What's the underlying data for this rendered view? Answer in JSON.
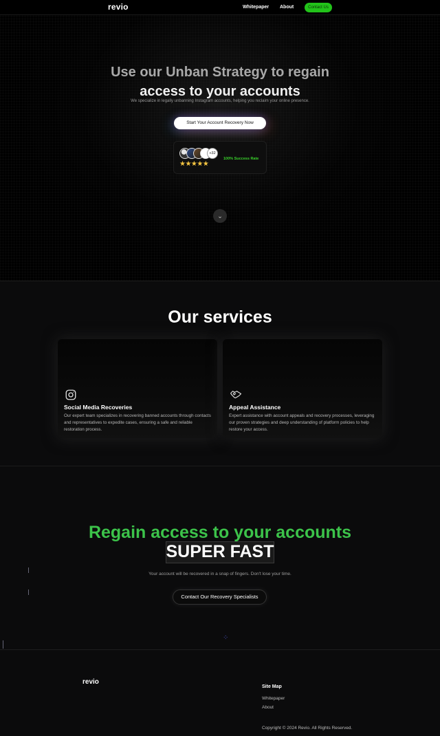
{
  "nav": {
    "logo": "revio",
    "links": [
      "Whitepaper",
      "About"
    ],
    "cta": "Contact Us"
  },
  "hero": {
    "title_line1": "Use our Unban Strategy to regain",
    "title_line2": "access to your accounts",
    "subtitle": "We specialize in legally unbanning Instagram accounts, helping you reclaim your online presence.",
    "button": "Start Your Account Recovery Now",
    "avatar_more": "+32",
    "stars": "★★★★★",
    "success_rate": "100% Success Rate",
    "scroll_icon": "chevron-down-icon"
  },
  "services": {
    "title": "Our services",
    "cards": [
      {
        "icon": "instagram-icon",
        "title": "Social Media Recoveries",
        "description": "Our expert team specializes in recovering banned accounts through contacts and representatives to expedite cases, ensuring a safe and reliable restoration process."
      },
      {
        "icon": "handshake-icon",
        "title": "Appeal Assistance",
        "description": "Expert assistance with account appeals and recovery processes, leveraging our proven strategies and deep understanding of platform policies to help restore your access."
      }
    ]
  },
  "cta": {
    "headline": "Regain access to your accounts",
    "highlight": "SUPER FAST",
    "subtitle": "Your account will be recovered in a snap of fingers. Don't lose your time.",
    "button": "Contact Our Recovery Specialists"
  },
  "footer": {
    "logo": "revio",
    "sitemap_title": "Site Map",
    "links": [
      "Whitepaper",
      "About"
    ],
    "copyright": "Copyright © 2024 Revio. All Rights Reserved."
  },
  "colors": {
    "accent_green": "#22c31a",
    "headline_green": "#3cc34a",
    "background": "#0b0b0c",
    "star": "#f5c542"
  }
}
